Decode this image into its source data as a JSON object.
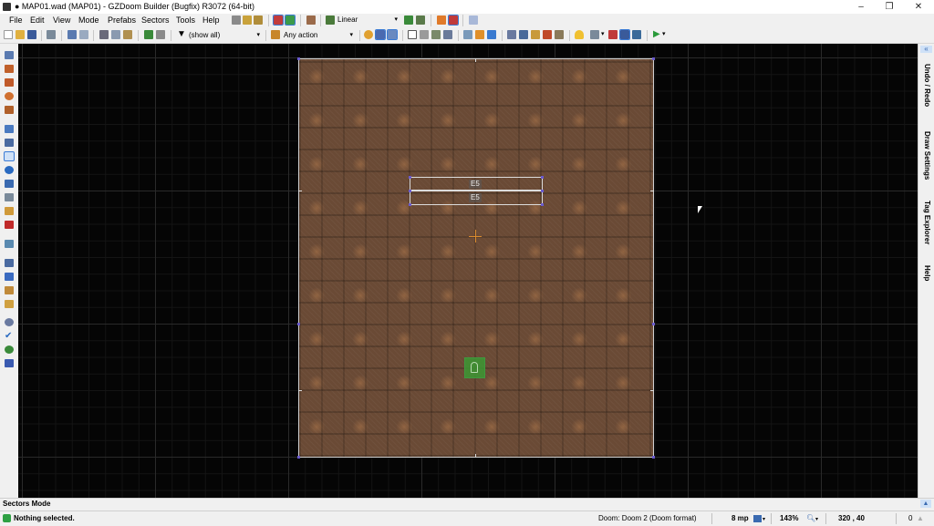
{
  "window": {
    "title": "● MAP01.wad (MAP01) - GZDoom Builder (Bugfix) R3072 (64-bit)",
    "minimize_glyph": "–",
    "maximize_glyph": "❐",
    "close_glyph": "✕"
  },
  "menu": [
    "File",
    "Edit",
    "View",
    "Mode",
    "Prefabs",
    "Sectors",
    "Tools",
    "Help"
  ],
  "top_toolbar": {
    "texture_filter": "Linear"
  },
  "toolbar": {
    "filter_label": "(show all)",
    "action_label": "Any action"
  },
  "map": {
    "tag_labels": [
      "E5",
      "E5"
    ]
  },
  "right_dock": {
    "collapse_glyph": "«",
    "tabs": [
      "Undo / Redo",
      "Draw Settings",
      "Tag Explorer",
      "Help"
    ]
  },
  "mode_bar": {
    "mode": "Sectors Mode"
  },
  "status": {
    "message": "Nothing selected.",
    "game_config": "Doom: Doom 2 (Doom format)",
    "grid": "8 mp",
    "zoom": "143%",
    "coords": "320 , 40",
    "selection_count": "0"
  },
  "colors": {
    "canvas_bg": "#050505",
    "sector_floor": "#6a4a35",
    "vertex": "#6a5acd",
    "start_thing": "#3c9632",
    "status_ok": "#2ea043"
  },
  "icons": {
    "left_toolbar": [
      "draw-lines-icon",
      "draw-curve-icon",
      "draw-rectangle-icon",
      "draw-ellipse-icon",
      "draw-grid-icon",
      "vertices-mode-icon",
      "linedefs-mode-icon",
      "sectors-mode-icon",
      "things-mode-icon",
      "visual-mode-icon",
      "make-sectors-icon",
      "sound-environment-icon",
      "sound-propagation-icon",
      "error-check-icon",
      "terrain-icon",
      "bridge-icon",
      "snap-icon",
      "find-icon",
      "check-icon",
      "color-picker-icon",
      "texture-icon"
    ]
  }
}
